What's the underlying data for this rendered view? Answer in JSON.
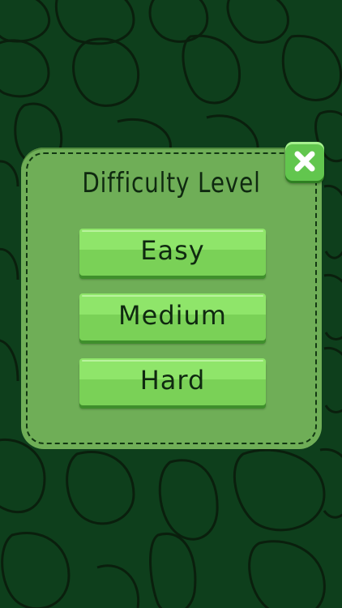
{
  "dialog": {
    "title": "Difficulty Level",
    "options": [
      {
        "label": "Easy"
      },
      {
        "label": "Medium"
      },
      {
        "label": "Hard"
      }
    ]
  },
  "icons": {
    "close": "close-icon"
  },
  "colors": {
    "background": "#0e3f1c",
    "pattern_stroke": "#0a1f0d",
    "panel": "#6fae57",
    "button": "#7ad157",
    "button_highlight": "#8fe56a",
    "close_button": "#62c64e",
    "text": "#0f2910"
  }
}
